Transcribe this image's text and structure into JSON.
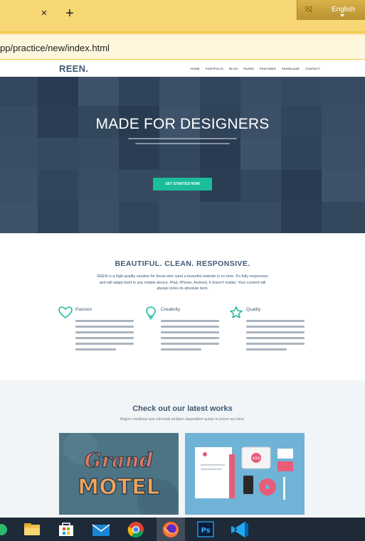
{
  "browser": {
    "tab_close": "×",
    "tab_new": "+",
    "language_button": {
      "glyph": "অ",
      "label": "English"
    },
    "url": "pp/practice/new/index.html"
  },
  "site": {
    "logo": "REEN.",
    "nav": [
      "HOME",
      "PORTFOLIO",
      "BLOG",
      "PAGES",
      "FEATURES",
      "SHOWCASE",
      "CONTACT"
    ],
    "hero": {
      "title": "MADE FOR DESIGNERS",
      "button": "GET STARTED NOW"
    },
    "features": {
      "title": "BEAUTIFUL. CLEAN. RESPONSIVE.",
      "text": "REEN is a high-quality solution for those who want a beautiful website in no time. It's fully responsive and will adapt itself to any mobile device. iPad, iPhone, Android, it doesn't matter. Your content will always looks its absolute best.",
      "items": [
        {
          "title": "Passion",
          "icon": "heart-icon"
        },
        {
          "title": "Creativity",
          "icon": "lightbulb-icon"
        },
        {
          "title": "Quality",
          "icon": "star-icon"
        }
      ]
    },
    "works": {
      "title": "Check out our latest works",
      "subtitle": "Magnis modipsae que voloratati andigen daepeditem quiate re porem aut labor.",
      "thumb1": {
        "line1": "Grand",
        "line2": "MOTEL"
      },
      "thumb2": {
        "badge": "REEN"
      }
    }
  },
  "taskbar": {
    "apps": [
      "file-explorer-icon",
      "microsoft-store-icon",
      "mail-icon",
      "chrome-icon",
      "firefox-icon",
      "photoshop-icon",
      "vscode-icon"
    ],
    "photoshop_label": "Ps"
  },
  "colors": {
    "accent": "#1abc9c",
    "brand": "#3f5972",
    "chrome": "#f7d774"
  }
}
